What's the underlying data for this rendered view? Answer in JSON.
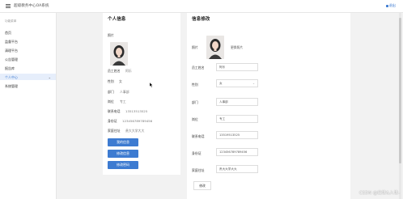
{
  "topbar": {
    "title": "超级教务中心OA系统",
    "logout": "退出"
  },
  "sidebar": {
    "header": "功能菜单",
    "items": [
      {
        "label": "首页"
      },
      {
        "label": "监督平台"
      },
      {
        "label": "清理平台"
      },
      {
        "label": "公告管理"
      },
      {
        "label": "报告库"
      },
      {
        "label": "个人中心",
        "active": true
      },
      {
        "label": "系统管理"
      }
    ]
  },
  "profile": {
    "title": "个人信息",
    "photo_label": "照片",
    "fields": [
      {
        "label": "员工姓名",
        "value": "阿乐"
      },
      {
        "label": "性别",
        "value": "女"
      },
      {
        "label": "部门",
        "value": "人事部"
      },
      {
        "label": "岗位",
        "value": "专工"
      },
      {
        "label": "联系电话",
        "value": "13513513525"
      },
      {
        "label": "身份证",
        "value": "123456789789456"
      },
      {
        "label": "家庭住址",
        "value": "贵大大学大大"
      }
    ],
    "buttons": [
      "我的信息",
      "修改信息",
      "修改密码"
    ]
  },
  "edit": {
    "title": "信息修改",
    "photo_label": "照片",
    "change_photo": "更换照片",
    "fields": [
      {
        "label": "员工姓名",
        "value": "阿乐"
      },
      {
        "label": "性别",
        "value": "女",
        "type": "select"
      },
      {
        "label": "部门",
        "value": "人事部"
      },
      {
        "label": "岗位",
        "value": "专工"
      },
      {
        "label": "联系电话",
        "value": "13519513525"
      },
      {
        "label": "身份证",
        "value": "123456789789456"
      },
      {
        "label": "家庭住址",
        "value": "贵大大学大大"
      }
    ],
    "save_label": "修改"
  },
  "watermark": "CSDN @出世&入世-",
  "colors": {
    "accent": "#3d7bd1",
    "sidebar_active_bg": "#e6eefb",
    "page_bg": "#f2f2f2"
  }
}
